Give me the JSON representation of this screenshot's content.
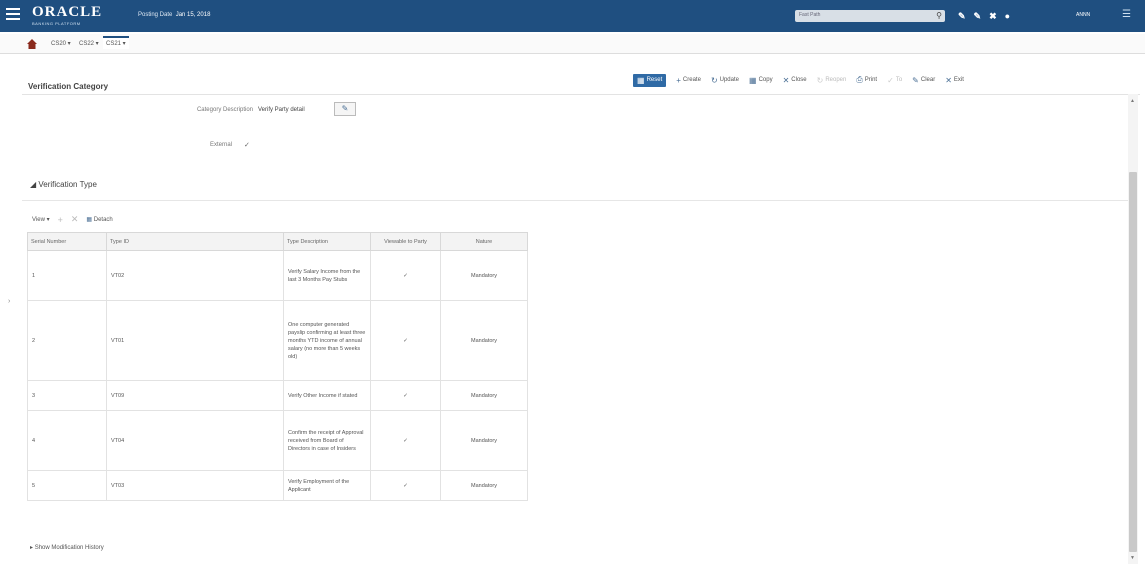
{
  "topbar": {
    "logo": "ORACLE",
    "logo_sub": "BANKING PLATFORM",
    "posting_label": "Posting Date",
    "posting_date": "Jan 15, 2018",
    "fast_path_placeholder": "Fast Path",
    "user": "ANNN",
    "color": "#1f4f80"
  },
  "tabs": [
    "CS20",
    "CS22",
    "CS21"
  ],
  "screen_title": "Verification Category",
  "toolbar": {
    "reset": "Reset",
    "create": "Create",
    "update": "Update",
    "copy": "Copy",
    "close": "Close",
    "reopen": "Reopen",
    "print": "Print",
    "clear": "Clear",
    "exit": "Exit"
  },
  "form": {
    "category_description_label": "Category Description",
    "category_description_value": "Verify Party detail",
    "external_label": "External"
  },
  "section_title": "Verification Type",
  "table_toolbar": {
    "view": "View",
    "detach": "Detach"
  },
  "table": {
    "headers": [
      "Serial Number",
      "Type ID",
      "Type Description",
      "Viewable to Party",
      "Nature"
    ],
    "rows": [
      {
        "serial": "1",
        "type_id": "VT02",
        "desc": "Verify Salary Income from the last 3 Months Pay Stubs",
        "nature": "Mandatory"
      },
      {
        "serial": "2",
        "type_id": "VT01",
        "desc": "One computer generated payslip confirming at least three months YTD income of annual salary (no more than 5 weeks old)",
        "nature": "Mandatory"
      },
      {
        "serial": "3",
        "type_id": "VT09",
        "desc": "Verify Other Income if stated",
        "nature": "Mandatory"
      },
      {
        "serial": "4",
        "type_id": "VT04",
        "desc": "Confirm the receipt of Approval received from Board of Directors in case of Insiders",
        "nature": "Mandatory"
      },
      {
        "serial": "5",
        "type_id": "VT03",
        "desc": "Verify Employment of the Applicant",
        "nature": "Mandatory"
      }
    ]
  },
  "history": "Show Modification History"
}
